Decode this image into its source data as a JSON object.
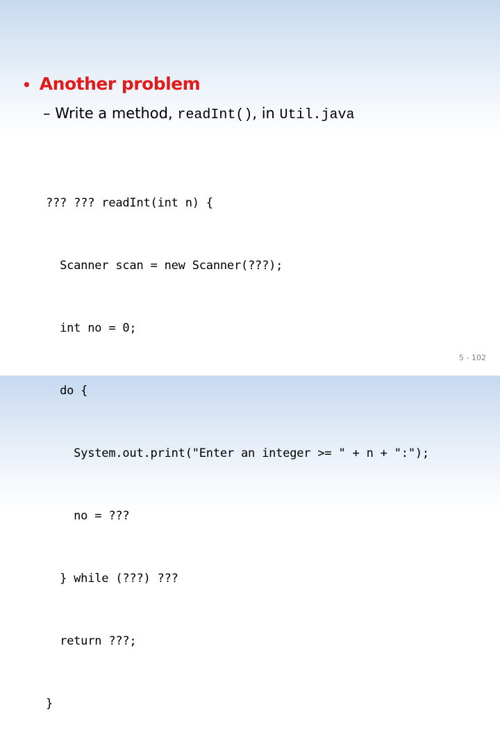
{
  "slide": {
    "bullet": {
      "symbol": "•",
      "text": "Another problem",
      "color": "#e01b1b"
    },
    "subbullet": {
      "dash": "– ",
      "prefix": "Write a method, ",
      "method": "readInt()",
      "middle": ", in ",
      "file": "Util.java"
    },
    "code_lines": [
      "??? ??? readInt(int n) {",
      "  Scanner scan = new Scanner(???);",
      "  int no = 0;",
      "  do {",
      "    System.out.print(\"Enter an integer >= \" + n + \":\");",
      "    no = ???",
      "  } while (???) ???",
      "  return ???;",
      "}"
    ],
    "page_number": "5 - 102"
  }
}
